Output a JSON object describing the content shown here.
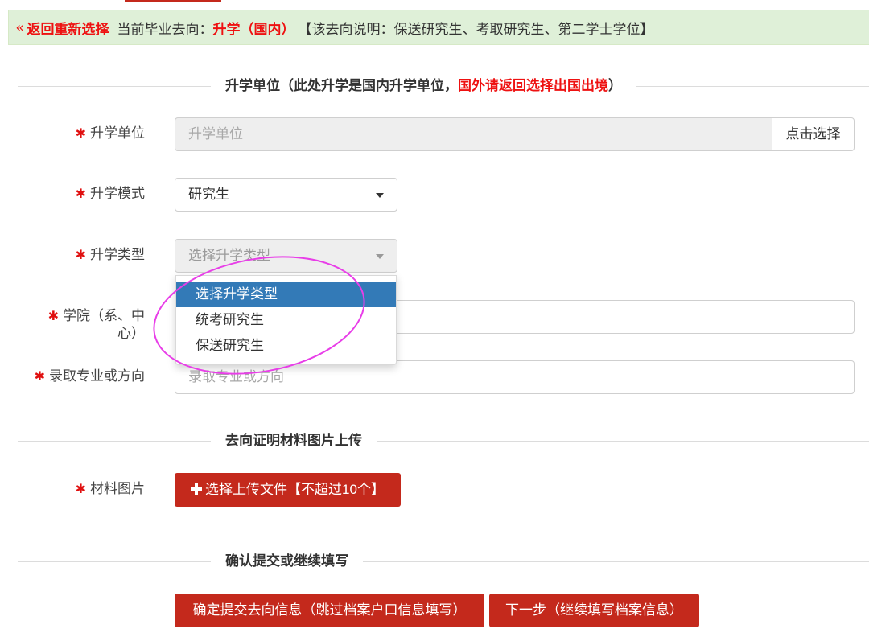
{
  "theme": {
    "accent": "#c4291c",
    "alert_red": "#ee1111",
    "required": "#e01010",
    "highlight": "#337ab7",
    "banner_bg": "#dff0d8",
    "banner_border": "#d6e9c6",
    "annotation": "#e83ee8"
  },
  "banner": {
    "back_icon": "«",
    "back_label": "返回重新选择",
    "current_label": "当前毕业去向：",
    "current_value": "升学（国内）",
    "description": "【该去向说明：保送研究生、考取研究生、第二学士学位】"
  },
  "required_mark": "✱",
  "section_school": {
    "heading_prefix": "升学单位（此处升学是国内升学单位，",
    "heading_warning": "国外请返回选择出国出境",
    "heading_suffix": "）",
    "fields": {
      "school": {
        "label": "升学单位",
        "placeholder": "升学单位",
        "button_label": "点击选择"
      },
      "mode": {
        "label": "升学模式",
        "value": "研究生"
      },
      "type": {
        "label": "升学类型",
        "value": "选择升学类型",
        "disabled": true,
        "highlighted": 0,
        "options": [
          "选择升学类型",
          "统考研究生",
          "保送研究生"
        ]
      },
      "college": {
        "label": "学院（系、中心）"
      },
      "major": {
        "label": "录取专业或方向",
        "placeholder": "录取专业或方向"
      }
    }
  },
  "section_upload": {
    "heading": "去向证明材料图片上传",
    "fields": {
      "images": {
        "label": "材料图片",
        "button_icon": "plus-icon",
        "button_label": "选择上传文件【不超过10个】"
      }
    }
  },
  "section_submit": {
    "heading": "确认提交或继续填写",
    "submit_label": "确定提交去向信息（跳过档案户口信息填写）",
    "next_label": "下一步（继续填写档案信息）"
  }
}
